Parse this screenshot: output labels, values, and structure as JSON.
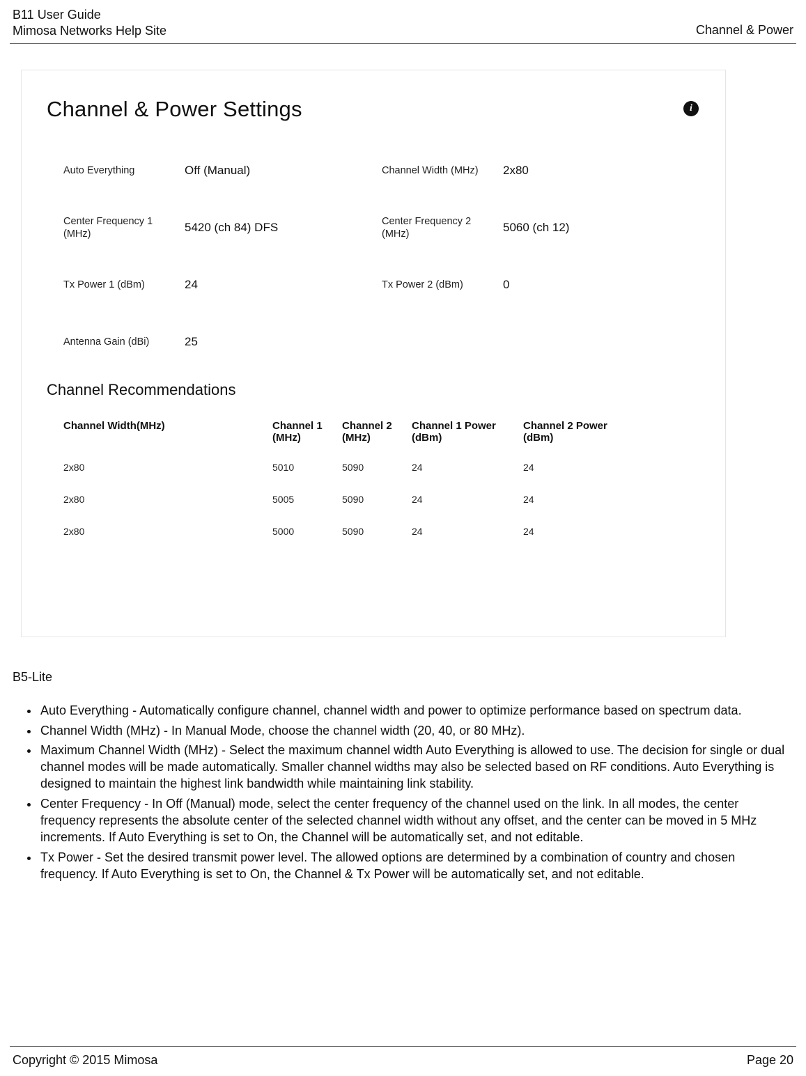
{
  "header": {
    "line1": "B11 User Guide",
    "line2": "Mimosa Networks Help Site",
    "right": "Channel & Power"
  },
  "panel": {
    "title": "Channel & Power Settings",
    "info_glyph": "i",
    "settings": {
      "auto_everything": {
        "label": "Auto Everything",
        "value": "Off (Manual)"
      },
      "channel_width": {
        "label": "Channel Width (MHz)",
        "value": "2x80"
      },
      "cfreq1": {
        "label": "Center Frequency 1 (MHz)",
        "value": "5420 (ch 84) DFS"
      },
      "cfreq2": {
        "label": "Center Frequency 2 (MHz)",
        "value": "5060 (ch 12)"
      },
      "txp1": {
        "label": "Tx Power 1 (dBm)",
        "value": "24"
      },
      "txp2": {
        "label": "Tx Power 2 (dBm)",
        "value": "0"
      },
      "antenna": {
        "label": "Antenna Gain (dBi)",
        "value": "25"
      }
    },
    "rec_title": "Channel Recommendations",
    "rec_headers": {
      "c0": "Channel Width(MHz)",
      "c1": "Channel 1 (MHz)",
      "c2": "Channel 2 (MHz)",
      "c3": "Channel 1 Power (dBm)",
      "c4": "Channel 2 Power (dBm)"
    },
    "rec_rows": [
      {
        "c0": "2x80",
        "c1": "5010",
        "c2": "5090",
        "c3": "24",
        "c4": "24"
      },
      {
        "c0": "2x80",
        "c1": "5005",
        "c2": "5090",
        "c3": "24",
        "c4": "24"
      },
      {
        "c0": "2x80",
        "c1": "5000",
        "c2": "5090",
        "c3": "24",
        "c4": "24"
      }
    ]
  },
  "body": {
    "lead": "B5-Lite",
    "bullets": [
      "Auto Everything - Automatically configure channel, channel width and power to optimize performance based on spectrum data.",
      "Channel Width (MHz) - In Manual Mode, choose the channel width (20, 40, or 80 MHz).",
      "Maximum Channel Width (MHz) - Select the maximum channel width Auto Everything is allowed to use. The decision for single or dual channel modes will be made automatically. Smaller channel widths may also be selected based on RF conditions. Auto Everything is designed to maintain the highest link bandwidth while maintaining link stability.",
      "Center Frequency - In Off (Manual) mode, select the center frequency of the channel used on the link. In all modes, the center frequency represents the absolute center of the selected channel width without any offset, and the center can be moved in 5 MHz increments. If Auto Everything is set to On, the Channel will be automatically set, and not editable.",
      "Tx Power - Set the desired transmit power level. The allowed options are determined by a combination of country and chosen frequency. If Auto Everything is set to On, the Channel & Tx Power will be automatically set, and not editable."
    ]
  },
  "footer": {
    "left": "Copyright © 2015 Mimosa",
    "right": "Page 20"
  }
}
